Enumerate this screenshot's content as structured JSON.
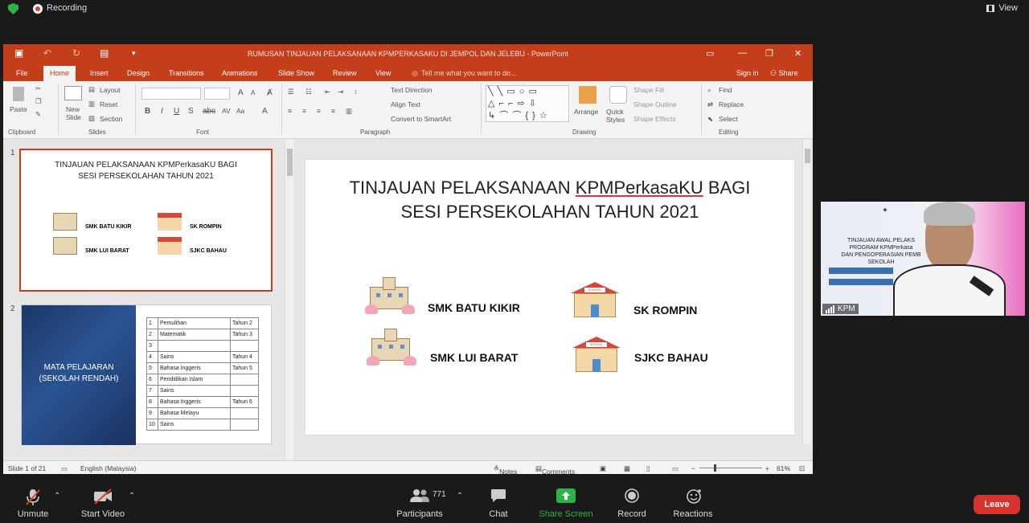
{
  "zoom_top": {
    "recording_label": "Recording",
    "view_label": "View"
  },
  "ppt": {
    "window_title": "RUMUSAN TINJAUAN PELAKSANAAN KPMPERKASAKU DI JEMPOL DAN JELEBU - PowerPoint",
    "tabs": [
      "File",
      "Home",
      "Insert",
      "Design",
      "Transitions",
      "Animations",
      "Slide Show",
      "Review",
      "View"
    ],
    "tell_me": "Tell me what you want to do...",
    "sign_in": "Sign in",
    "share": "Share",
    "ribbon": {
      "paste": "Paste",
      "new_slide": "New Slide",
      "layout": "Layout",
      "reset": "Reset",
      "section": "Section",
      "groups": [
        "Clipboard",
        "Slides",
        "Font",
        "Paragraph",
        "Drawing",
        "Editing"
      ],
      "text_direction": "Text Direction",
      "align_text": "Align Text",
      "convert_smartart": "Convert to SmartArt",
      "arrange": "Arrange",
      "quick_styles": "Quick Styles",
      "shape_fill": "Shape Fill",
      "shape_outline": "Shape Outline",
      "shape_effects": "Shape Effects",
      "find": "Find",
      "replace": "Replace",
      "select": "Select"
    },
    "thumbnails": {
      "slide1": {
        "num": "1",
        "title_line1": "TINJAUAN PELAKSANAAN  KPMPerkasaKU  BAGI",
        "title_line2": "SESI PERSEKOLAHAN TAHUN 2021",
        "schools": [
          "SMK BATU KIKIR",
          "SK ROMPIN",
          "SMK LUI BARAT",
          "SJKC BAHAU"
        ]
      },
      "slide2": {
        "num": "2",
        "left_line1": "MATA PELAJARAN",
        "left_line2": "(SEKOLAH RENDAH)",
        "rows": [
          [
            "1",
            "Pemulihan",
            "Tahun 2"
          ],
          [
            "2",
            "Matematik",
            "Tahun 3"
          ],
          [
            "3",
            "",
            ""
          ],
          [
            "4",
            "Sains",
            "Tahun 4"
          ],
          [
            "5",
            "Bahasa Inggeris",
            "Tahun 5"
          ],
          [
            "6",
            "Pendidikan Islam",
            ""
          ],
          [
            "7",
            "Sains",
            ""
          ],
          [
            "8",
            "Bahasa Inggeris",
            "Tahun 6"
          ],
          [
            "9",
            "Bahasa Melayu",
            ""
          ],
          [
            "10",
            "Sains",
            ""
          ]
        ]
      }
    },
    "slide": {
      "title_line1_pre": "TINJAUAN PELAKSANAAN ",
      "title_line1_u": "KPMPerkasaKU",
      "title_line1_post": " BAGI",
      "title_line2": "SESI PERSEKOLAHAN TAHUN 2021",
      "schools": [
        "SMK BATU KIKIR",
        "SK ROMPIN",
        "SMK LUI BARAT",
        "SJKC BAHAU"
      ]
    },
    "status": {
      "slide_of": "Slide 1 of 21",
      "language": "English (Malaysia)",
      "notes": "Notes",
      "comments": "Comments",
      "zoom": "61%"
    }
  },
  "video": {
    "participant_name": "KPM",
    "bg_text_line1": "TINJAUAN AWAL PELAKS",
    "bg_text_line2": "PROGRAM KPMPerkasa",
    "bg_text_line3": "DAN PENGOPERASIAN PEMB",
    "bg_text_line4": "SEKOLAH"
  },
  "zoom_bottom": {
    "unmute": "Unmute",
    "start_video": "Start Video",
    "participants": "Participants",
    "participants_count": "771",
    "chat": "Chat",
    "share_screen": "Share Screen",
    "record": "Record",
    "reactions": "Reactions",
    "leave": "Leave"
  },
  "colors": {
    "ppt_accent": "#c43e1c",
    "zoom_bg": "#1a1a1a",
    "share_green": "#2db34a",
    "leave_red": "#d8322d"
  }
}
